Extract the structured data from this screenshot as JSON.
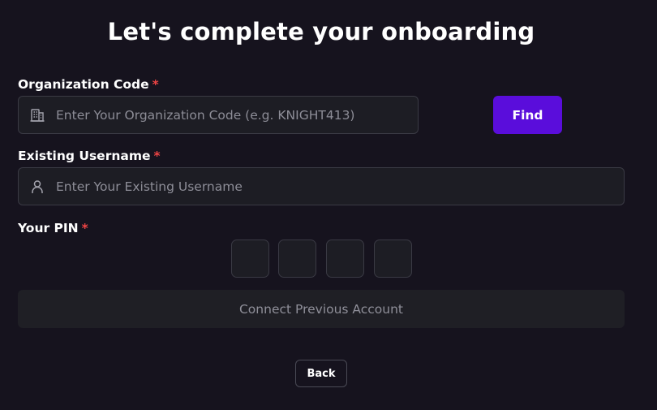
{
  "header": {
    "title": "Let's complete your onboarding"
  },
  "org_code": {
    "label": "Organization Code",
    "required_mark": "*",
    "placeholder": "Enter Your Organization Code (e.g. KNIGHT413)",
    "value": "",
    "icon": "building-icon",
    "find_label": "Find"
  },
  "username": {
    "label": "Existing Username",
    "required_mark": "*",
    "placeholder": "Enter Your Existing Username",
    "value": "",
    "icon": "user-icon"
  },
  "pin": {
    "label": "Your PIN",
    "required_mark": "*",
    "digits": [
      "",
      "",
      "",
      ""
    ]
  },
  "actions": {
    "connect_label": "Connect Previous Account",
    "back_label": "Back"
  },
  "colors": {
    "background": "#16131e",
    "input_bg": "#1d1d24",
    "accent": "#5a0ddb",
    "required": "#ef4444"
  }
}
